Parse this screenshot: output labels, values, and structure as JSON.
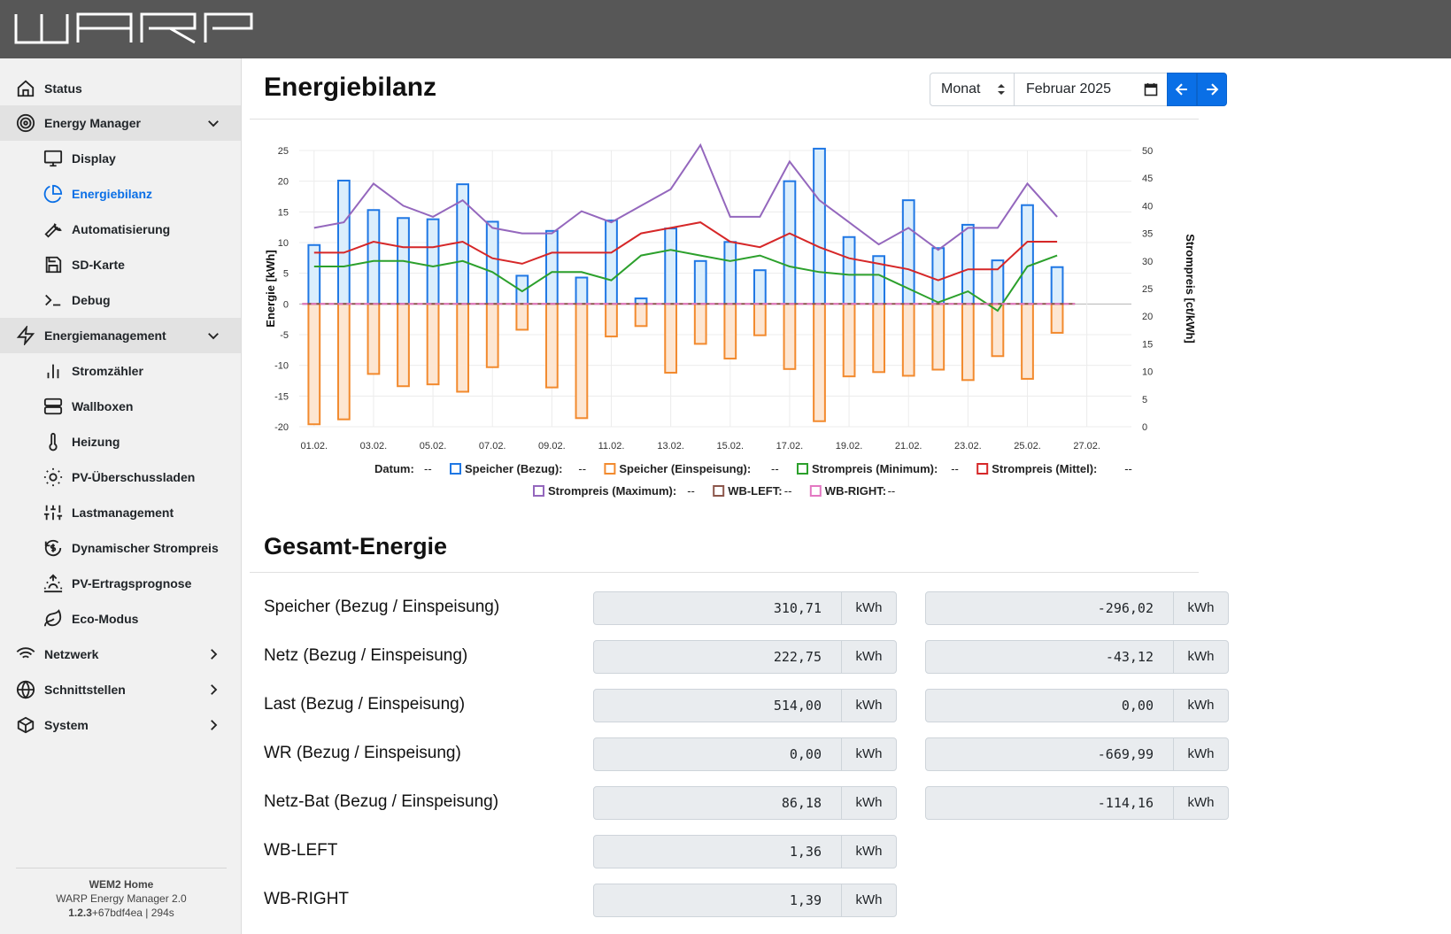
{
  "header": {
    "logo_text": "WARP"
  },
  "sidebar": {
    "items": [
      {
        "label": "Status",
        "icon": "home-icon",
        "level": "top"
      },
      {
        "label": "Energy Manager",
        "icon": "target-icon",
        "level": "top",
        "expanded": true
      },
      {
        "label": "Display",
        "icon": "monitor-icon",
        "level": "sub"
      },
      {
        "label": "Energiebilanz",
        "icon": "pie-chart-icon",
        "level": "sub",
        "active": true
      },
      {
        "label": "Automatisierung",
        "icon": "wrench-icon",
        "level": "sub"
      },
      {
        "label": "SD-Karte",
        "icon": "save-icon",
        "level": "sub"
      },
      {
        "label": "Debug",
        "icon": "terminal-icon",
        "level": "sub"
      },
      {
        "label": "Energiemanagement",
        "icon": "zap-icon",
        "level": "top",
        "expanded": true
      },
      {
        "label": "Stromzähler",
        "icon": "bar-chart-icon",
        "level": "sub"
      },
      {
        "label": "Wallboxen",
        "icon": "server-icon",
        "level": "sub"
      },
      {
        "label": "Heizung",
        "icon": "thermometer-icon",
        "level": "sub"
      },
      {
        "label": "PV-Überschussladen",
        "icon": "sun-icon",
        "level": "sub"
      },
      {
        "label": "Lastmanagement",
        "icon": "sliders-icon",
        "level": "sub"
      },
      {
        "label": "Dynamischer Strompreis",
        "icon": "clock-dollar-icon",
        "level": "sub"
      },
      {
        "label": "PV-Ertragsprognose",
        "icon": "sunrise-icon",
        "level": "sub"
      },
      {
        "label": "Eco-Modus",
        "icon": "leaf-icon",
        "level": "sub"
      },
      {
        "label": "Netzwerk",
        "icon": "wifi-icon",
        "level": "top",
        "expanded": false
      },
      {
        "label": "Schnittstellen",
        "icon": "globe-icon",
        "level": "top",
        "expanded": false
      },
      {
        "label": "System",
        "icon": "box-icon",
        "level": "top",
        "expanded": false
      }
    ],
    "footer": {
      "device": "WEM2 Home",
      "product": "WARP Energy Manager 2.0",
      "version_bold": "1.2.3",
      "version_rest": "+67bdf4ea | 294s"
    }
  },
  "page": {
    "title": "Energiebilanz",
    "range_select": "Monat",
    "month_value": "Februar 2025",
    "section_title": "Gesamt-Energie"
  },
  "colors": {
    "accent": "#0a6fe6",
    "speicher_bezug": "#1f77e4",
    "speicher_einspeisung": "#f28a2e",
    "strompreis_min": "#2ca02c",
    "strompreis_mittel": "#d62728",
    "strompreis_max": "#9467bd",
    "wb_left": "#8c564b",
    "wb_right": "#e377c2"
  },
  "chart_data": {
    "type": "bar",
    "x": [
      "01.02.",
      "02.02.",
      "03.02.",
      "04.02.",
      "05.02.",
      "06.02.",
      "07.02.",
      "08.02.",
      "09.02.",
      "10.02.",
      "11.02.",
      "12.02.",
      "13.02.",
      "14.02.",
      "15.02.",
      "16.02.",
      "17.02.",
      "18.02.",
      "19.02.",
      "20.02.",
      "21.02.",
      "22.02.",
      "23.02.",
      "24.02.",
      "25.02.",
      "26.02."
    ],
    "x_ticks": [
      "01.02.",
      "03.02.",
      "05.02.",
      "07.02.",
      "09.02.",
      "11.02.",
      "13.02.",
      "15.02.",
      "17.02.",
      "19.02.",
      "21.02.",
      "23.02.",
      "25.02.",
      "27.02."
    ],
    "ylabel": "Energie [kWh]",
    "ylim": [
      -20,
      25
    ],
    "y_ticks": [
      25,
      20,
      15,
      10,
      5,
      0,
      -5,
      -10,
      -15,
      -20
    ],
    "y2label": "Strompreis [ct/kWh]",
    "y2lim": [
      0,
      50
    ],
    "y2_ticks": [
      50,
      45,
      40,
      35,
      30,
      25,
      20,
      15,
      10,
      5,
      0
    ],
    "grid": true,
    "legend_position": "bottom",
    "legend_label_datum": "Datum:",
    "legend_value": "--",
    "series": [
      {
        "name": "Speicher (Bezug)",
        "axis": "left",
        "kind": "bar",
        "values": [
          9.6,
          20.1,
          15.3,
          14,
          13.8,
          19.5,
          13.4,
          4.6,
          11.9,
          4.3,
          13.6,
          0.9,
          12.3,
          7,
          10.1,
          5.5,
          20,
          25.3,
          10.9,
          7.8,
          16.9,
          9.1,
          12.9,
          7.1,
          16.1,
          6
        ]
      },
      {
        "name": "Speicher (Einspeisung)",
        "axis": "left",
        "kind": "bar",
        "values": [
          -19.6,
          -18.8,
          -11.4,
          -13.4,
          -13.1,
          -14.3,
          -10.3,
          -4.2,
          -13.6,
          -18.6,
          -5.3,
          -3.6,
          -11.2,
          -6.5,
          -8.9,
          -5.1,
          -10.6,
          -19.1,
          -11.8,
          -11.1,
          -11.7,
          -10.7,
          -12.4,
          -8.5,
          -12.2,
          -4.7
        ]
      },
      {
        "name": "Strompreis (Minimum)",
        "axis": "right",
        "kind": "line",
        "values": [
          29,
          29,
          30,
          30,
          29,
          30,
          28,
          24.5,
          28,
          28,
          26.5,
          31,
          32,
          31,
          30,
          31,
          29,
          28,
          27.5,
          27.5,
          25,
          22.5,
          24.5,
          21,
          29,
          31
        ]
      },
      {
        "name": "Strompreis (Mittel)",
        "axis": "right",
        "kind": "line",
        "values": [
          31.5,
          31.5,
          33.5,
          32.5,
          32.5,
          33.5,
          30.5,
          29.5,
          31.5,
          31.5,
          31.5,
          35,
          36,
          37,
          33.5,
          32.5,
          35,
          32.5,
          30.5,
          29.5,
          28.5,
          26.5,
          28.5,
          28.5,
          33.5,
          33.5
        ]
      },
      {
        "name": "Strompreis (Maximum)",
        "axis": "right",
        "kind": "line",
        "values": [
          36,
          37,
          44,
          40,
          38,
          41,
          36,
          35,
          35,
          39,
          37,
          40,
          43,
          51,
          38,
          38,
          48,
          41,
          37,
          33,
          36,
          32,
          36,
          36,
          44,
          38
        ]
      },
      {
        "name": "WB-LEFT",
        "axis": "left",
        "kind": "line",
        "values": [
          0,
          0,
          0,
          0,
          0,
          0,
          0,
          0,
          0,
          0,
          0,
          0,
          0,
          0,
          0,
          0,
          0,
          0,
          0,
          0,
          0,
          0,
          0,
          0,
          0,
          0
        ]
      },
      {
        "name": "WB-RIGHT",
        "axis": "left",
        "kind": "line",
        "values": [
          0,
          0,
          0,
          0,
          0,
          0,
          0,
          0,
          0,
          0,
          0,
          0,
          0,
          0,
          0,
          0,
          0,
          0,
          0,
          0,
          0,
          0,
          0,
          0,
          0,
          0
        ]
      }
    ]
  },
  "energy_rows": [
    {
      "label": "Speicher (Bezug / Einspeisung)",
      "bezug": "310,71",
      "einspeisung": "-296,02",
      "unit": "kWh"
    },
    {
      "label": "Netz (Bezug / Einspeisung)",
      "bezug": "222,75",
      "einspeisung": "-43,12",
      "unit": "kWh"
    },
    {
      "label": "Last (Bezug / Einspeisung)",
      "bezug": "514,00",
      "einspeisung": "0,00",
      "unit": "kWh"
    },
    {
      "label": "WR (Bezug / Einspeisung)",
      "bezug": "0,00",
      "einspeisung": "-669,99",
      "unit": "kWh"
    },
    {
      "label": "Netz-Bat (Bezug / Einspeisung)",
      "bezug": "86,18",
      "einspeisung": "-114,16",
      "unit": "kWh"
    },
    {
      "label": "WB-LEFT",
      "bezug": "1,36",
      "unit": "kWh"
    },
    {
      "label": "WB-RIGHT",
      "bezug": "1,39",
      "unit": "kWh"
    }
  ]
}
